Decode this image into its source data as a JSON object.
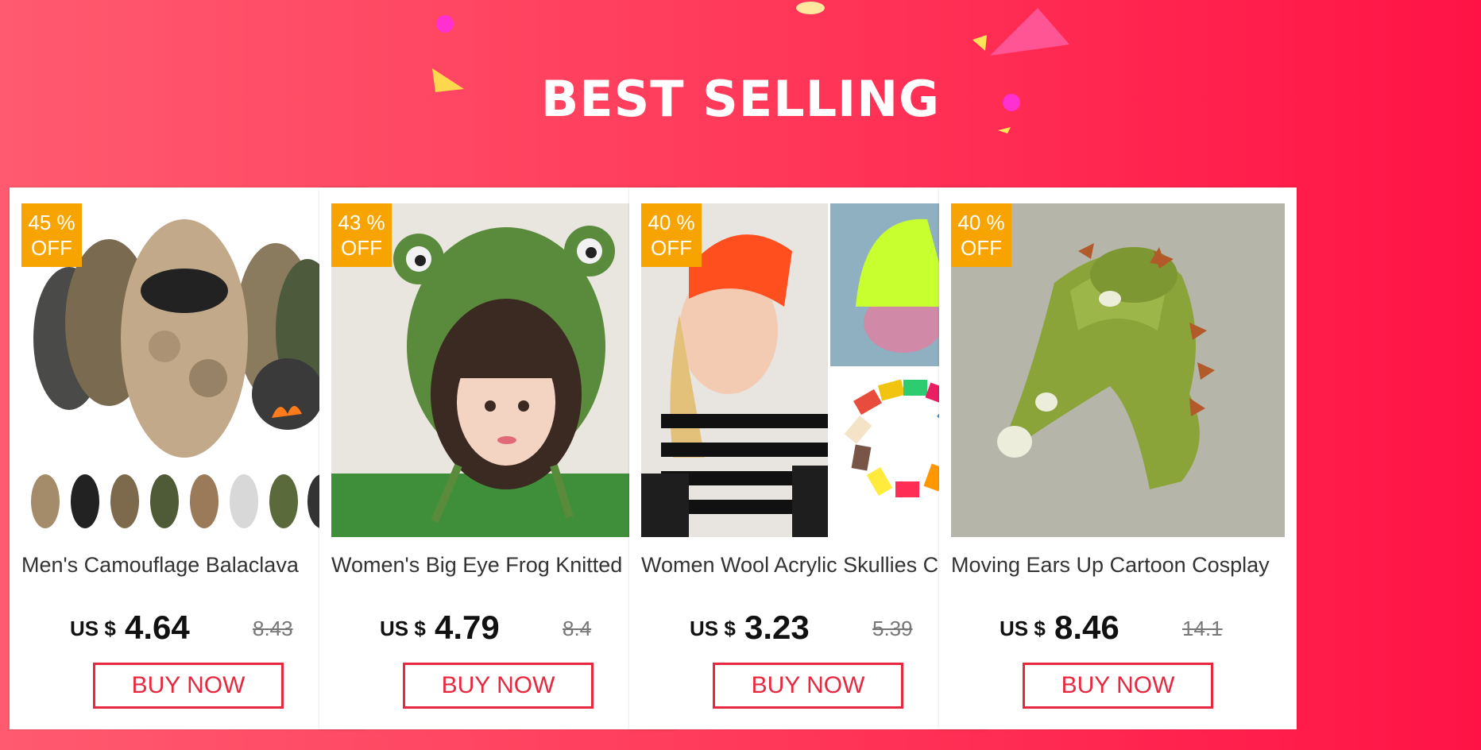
{
  "banner": {
    "title": "BEST SELLING",
    "colors": {
      "start": "#ff5a6f",
      "end": "#ff1346",
      "accent": "#e8283f",
      "badge": "#f7a400"
    }
  },
  "products": [
    {
      "badge_pct": "45 %",
      "badge_off": "OFF",
      "name": "Men's Camouflage Balaclava",
      "currency": "US $",
      "price": "4.64",
      "old_price": "8.43",
      "buy_label": "BUY NOW",
      "image": "camouflage-balaclava-image"
    },
    {
      "badge_pct": "43 %",
      "badge_off": "OFF",
      "name": "Women's Big Eye Frog Knitted",
      "currency": "US $",
      "price": "4.79",
      "old_price": "8.4",
      "buy_label": "BUY NOW",
      "image": "frog-knitted-hat-image"
    },
    {
      "badge_pct": "40 %",
      "badge_off": "OFF",
      "name": "Women Wool Acrylic Skullies Cap",
      "currency": "US $",
      "price": "3.23",
      "old_price": "5.39",
      "buy_label": "BUY NOW",
      "image": "skullies-cap-image"
    },
    {
      "badge_pct": "40 %",
      "badge_off": "OFF",
      "name": "Moving Ears Up Cartoon Cosplay",
      "currency": "US $",
      "price": "8.46",
      "old_price": "14.1",
      "buy_label": "BUY NOW",
      "image": "dinosaur-hat-image"
    }
  ]
}
